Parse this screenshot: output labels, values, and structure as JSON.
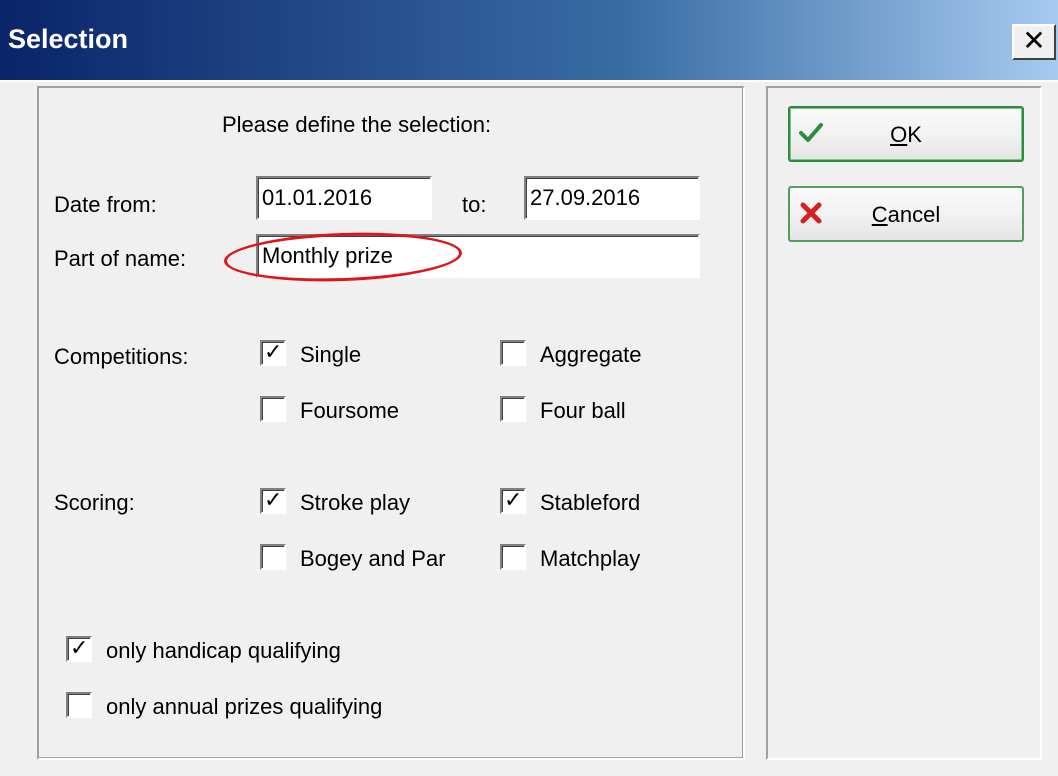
{
  "window": {
    "title": "Selection",
    "close_label": "X"
  },
  "form": {
    "heading": "Please define the selection:",
    "date_from_label": "Date from:",
    "date_from_value": "01.01.2016",
    "to_label": "to:",
    "date_to_value": "27.09.2016",
    "name_label": "Part of name:",
    "name_value": "Monthly prize"
  },
  "competitions": {
    "label": "Competitions:",
    "options": [
      {
        "label": "Single",
        "checked": true
      },
      {
        "label": "Aggregate",
        "checked": false
      },
      {
        "label": "Foursome",
        "checked": false
      },
      {
        "label": "Four ball",
        "checked": false
      }
    ]
  },
  "scoring": {
    "label": "Scoring:",
    "options": [
      {
        "label": "Stroke play",
        "checked": true
      },
      {
        "label": "Stableford",
        "checked": true
      },
      {
        "label": "Bogey and Par",
        "checked": false
      },
      {
        "label": "Matchplay",
        "checked": false
      }
    ]
  },
  "qualifying": [
    {
      "label": "only handicap qualifying",
      "checked": true
    },
    {
      "label": "only annual prizes qualifying",
      "checked": false
    }
  ],
  "buttons": {
    "ok_label": "OK",
    "cancel_label": "Cancel"
  },
  "colors": {
    "accent_green": "#2e8b3e",
    "highlight_red": "#e0141b",
    "titlebar_dark": "#0a246a"
  }
}
